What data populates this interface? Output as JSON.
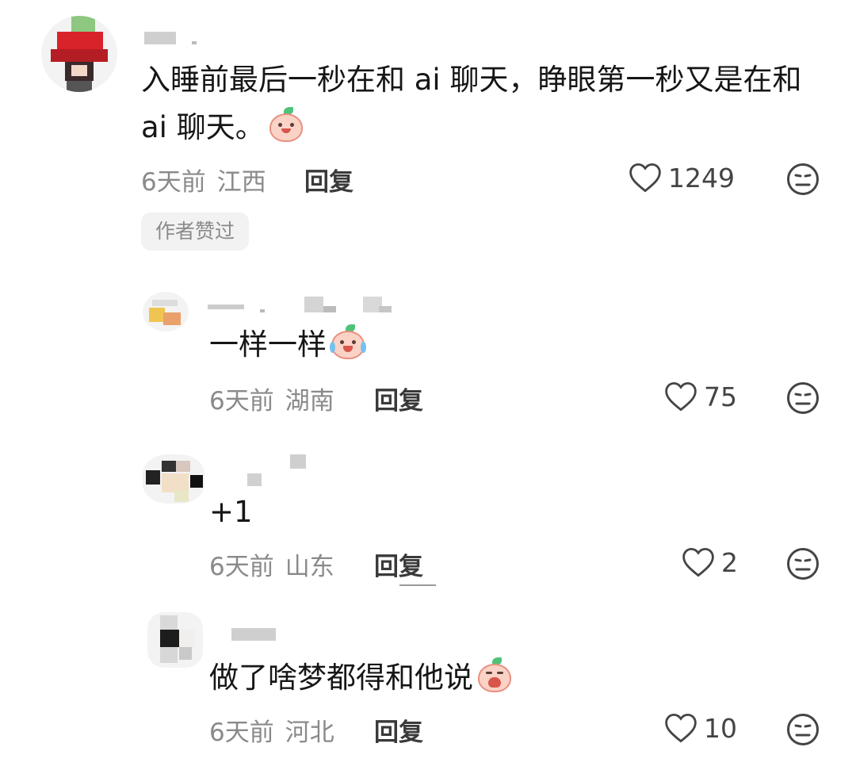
{
  "comments": [
    {
      "text_line1": "入睡前最后一秒在和 ai 聊天，睁眼第一秒又是在和",
      "text_line2": "ai 聊天。",
      "emoji": "smile-emoji",
      "time": "6天前",
      "location": "江西",
      "reply_label": "回复",
      "likes": "1249",
      "badge": "作者赞过"
    },
    {
      "text": "一样一样",
      "emoji": "crying-laugh-emoji",
      "time": "6天前",
      "location": "湖南",
      "reply_label": "回复",
      "likes": "75"
    },
    {
      "text": "+1",
      "time": "6天前",
      "location": "山东",
      "reply_label": "回复",
      "likes": "2"
    },
    {
      "text": "做了啥梦都得和他说",
      "emoji": "wailing-emoji",
      "time": "6天前",
      "location": "河北",
      "reply_label": "回复",
      "likes": "10"
    }
  ],
  "icons": {
    "like": "heart-outline-icon",
    "dislike": "meh-face-icon"
  },
  "colors": {
    "text": "#161616",
    "meta": "#8a8a8a",
    "icon": "#444444",
    "badge_bg": "#f2f2f2"
  }
}
